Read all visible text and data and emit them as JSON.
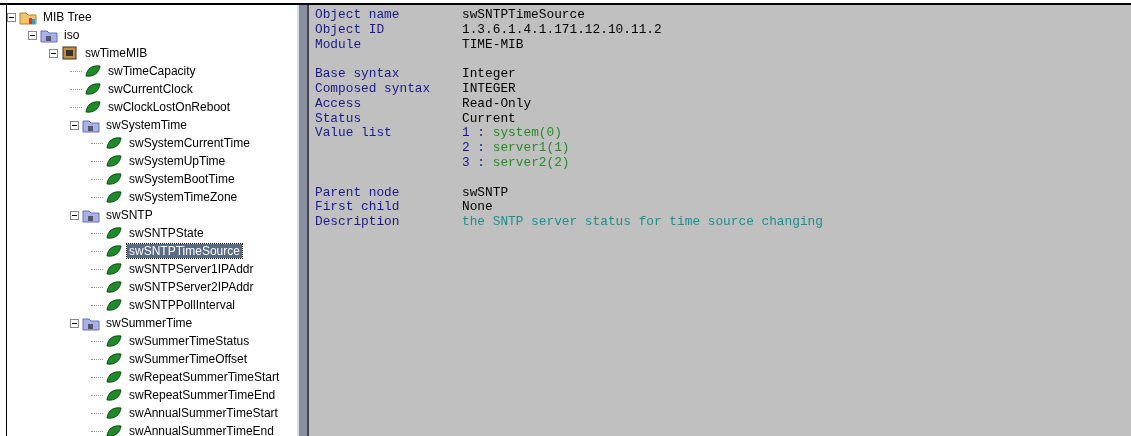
{
  "tree": [
    {
      "label": "MIB Tree",
      "kind": "root",
      "expanded": true,
      "selected": false,
      "children": [
        {
          "label": "iso",
          "kind": "folder",
          "expanded": true,
          "selected": false,
          "children": [
            {
              "label": "swTimeMIB",
              "kind": "module",
              "expanded": true,
              "selected": false,
              "children": [
                {
                  "label": "swTimeCapacity",
                  "kind": "leaf",
                  "selected": false
                },
                {
                  "label": "swCurrentClock",
                  "kind": "leaf",
                  "selected": false
                },
                {
                  "label": "swClockLostOnReboot",
                  "kind": "leaf",
                  "selected": false
                },
                {
                  "label": "swSystemTime",
                  "kind": "folder",
                  "expanded": true,
                  "selected": false,
                  "children": [
                    {
                      "label": "swSystemCurrentTime",
                      "kind": "leaf",
                      "selected": false
                    },
                    {
                      "label": "swSystemUpTime",
                      "kind": "leaf",
                      "selected": false
                    },
                    {
                      "label": "swSystemBootTime",
                      "kind": "leaf",
                      "selected": false
                    },
                    {
                      "label": "swSystemTimeZone",
                      "kind": "leaf",
                      "selected": false
                    }
                  ]
                },
                {
                  "label": "swSNTP",
                  "kind": "folder",
                  "expanded": true,
                  "selected": false,
                  "children": [
                    {
                      "label": "swSNTPState",
                      "kind": "leaf",
                      "selected": false
                    },
                    {
                      "label": "swSNTPTimeSource",
                      "kind": "leaf",
                      "selected": true
                    },
                    {
                      "label": "swSNTPServer1IPAddr",
                      "kind": "leaf",
                      "selected": false
                    },
                    {
                      "label": "swSNTPServer2IPAddr",
                      "kind": "leaf",
                      "selected": false
                    },
                    {
                      "label": "swSNTPPollInterval",
                      "kind": "leaf",
                      "selected": false
                    }
                  ]
                },
                {
                  "label": "swSummerTime",
                  "kind": "folder",
                  "expanded": true,
                  "selected": false,
                  "children": [
                    {
                      "label": "swSummerTimeStatus",
                      "kind": "leaf",
                      "selected": false
                    },
                    {
                      "label": "swSummerTimeOffset",
                      "kind": "leaf",
                      "selected": false
                    },
                    {
                      "label": "swRepeatSummerTimeStart",
                      "kind": "leaf",
                      "selected": false
                    },
                    {
                      "label": "swRepeatSummerTimeEnd",
                      "kind": "leaf",
                      "selected": false
                    },
                    {
                      "label": "swAnnualSummerTimeStart",
                      "kind": "leaf",
                      "selected": false
                    },
                    {
                      "label": "swAnnualSummerTimeEnd",
                      "kind": "leaf",
                      "selected": false
                    }
                  ]
                }
              ]
            }
          ]
        }
      ]
    }
  ],
  "details": [
    [
      {
        "label": "Object name",
        "kind": "plain",
        "value": "swSNTPTimeSource"
      },
      {
        "label": "Object ID",
        "kind": "plain",
        "value": "1.3.6.1.4.1.171.12.10.11.2"
      },
      {
        "label": "Module",
        "kind": "plain",
        "value": "TIME-MIB"
      }
    ],
    [
      {
        "label": "Base syntax",
        "kind": "plain",
        "value": "Integer"
      },
      {
        "label": "Composed syntax",
        "kind": "plain",
        "value": "INTEGER"
      },
      {
        "label": "Access",
        "kind": "plain",
        "value": "Read-Only"
      },
      {
        "label": "Status",
        "kind": "plain",
        "value": "Current"
      },
      {
        "label": "Value list",
        "kind": "list",
        "values": [
          {
            "number": "1 :",
            "name": "system(0)"
          },
          {
            "number": "2 :",
            "name": "server1(1)"
          },
          {
            "number": "3 :",
            "name": "server2(2)"
          }
        ]
      }
    ],
    [
      {
        "label": "Parent node",
        "kind": "plain",
        "value": "swSNTP"
      },
      {
        "label": "First child",
        "kind": "plain",
        "value": "None"
      },
      {
        "label": "Description",
        "kind": "description",
        "value": "the SNTP server status for time source changing"
      }
    ]
  ]
}
